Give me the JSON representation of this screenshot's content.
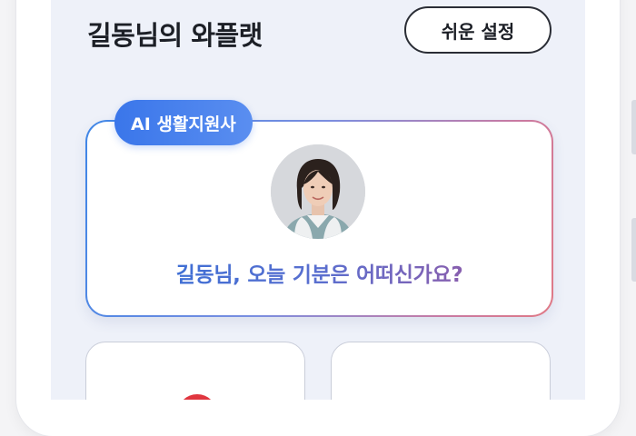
{
  "header": {
    "title": "길동님의 와플랫",
    "settings_label": "쉬운 설정"
  },
  "ai_card": {
    "badge_label": "AI 생활지원사",
    "avatar_icon": "woman-portrait",
    "greeting": "길동님, 오늘 기분은 어떠신가요?"
  },
  "colors": {
    "accent_blue": "#3a76ea",
    "accent_pink": "#e07a86",
    "background": "#eef1f9"
  },
  "icons": {
    "left_card_icon": "red-circle-icon"
  }
}
